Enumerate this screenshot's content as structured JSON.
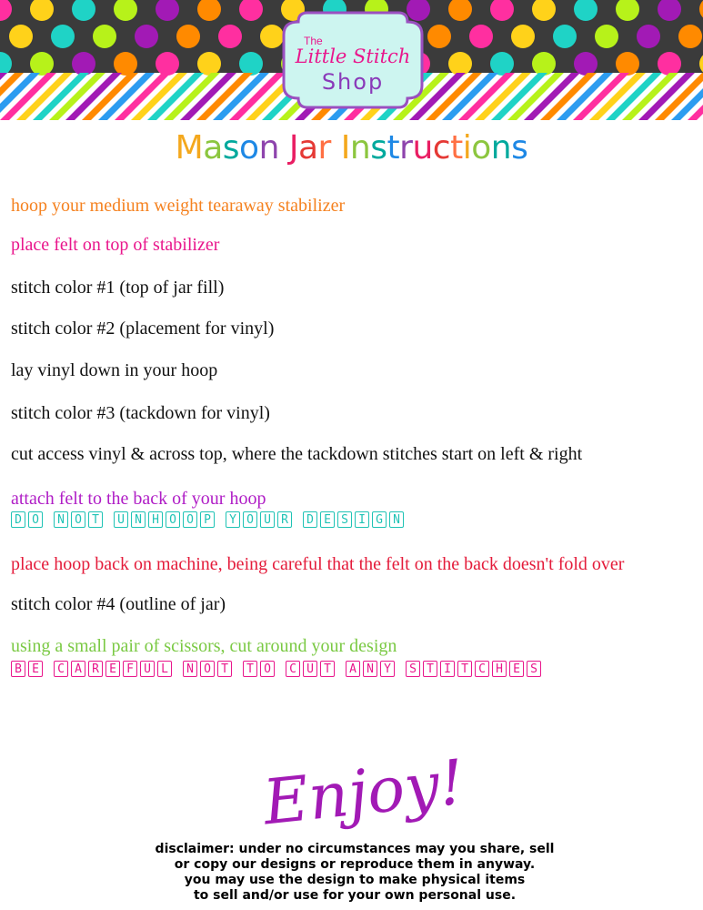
{
  "logo": {
    "the": "The",
    "line1": "Little Stitch",
    "line2": "Shop"
  },
  "title": {
    "text": "Mason Jar Instructions",
    "rainbow": [
      "#f4a81d",
      "#8cc63f",
      "#00a99d",
      "#1e88e5",
      "#8e44ad",
      "#e91e63",
      "#e53935",
      "#ff7043"
    ]
  },
  "steps": [
    {
      "text": "hoop your medium weight tearaway stabilizer",
      "color": "#f58220"
    },
    {
      "text": "place felt on top of stabilizer",
      "color": "#e9168c"
    },
    {
      "text": "stitch color #1 (top of jar fill)",
      "color": "#111111"
    },
    {
      "text": "stitch color #2 (placement for vinyl)",
      "color": "#111111"
    },
    {
      "text": "lay vinyl down in your hoop",
      "color": "#111111"
    },
    {
      "text": "stitch color #3 (tackdown for vinyl)",
      "color": "#111111"
    },
    {
      "text": "cut access vinyl & across top, where the tackdown stitches start on left & right",
      "color": "#111111"
    },
    {
      "text": "attach felt to the back of your hoop",
      "color": "#b01ec6"
    },
    {
      "text": "DO NOT UNHOOP YOUR DESIGN",
      "color": "#1fc3b5",
      "boxed": true
    },
    {
      "text": "place hoop back on machine, being careful that the felt on the back doesn't fold over",
      "color": "#e41b3a"
    },
    {
      "text": "stitch color #4 (outline of jar)",
      "color": "#111111"
    },
    {
      "text": "using a small pair of scissors, cut around your design",
      "color": "#7ac943"
    },
    {
      "text": "BE CAREFUL NOT TO CUT ANY STITCHES",
      "color": "#e9168c",
      "boxed": true
    }
  ],
  "enjoy": "Enjoy!",
  "disclaimer": [
    "disclaimer: under no circumstances may you share, sell",
    "or copy our designs or reproduce them in anyway.",
    "you may use the design to make physical items",
    "to sell and/or use for your own personal use."
  ],
  "colors": {
    "header_dark": "#3b3b3b",
    "polka": [
      "#ff2fa0",
      "#ffd21a",
      "#1fd3c6",
      "#b7f21a",
      "#a21ab5",
      "#ff8a00"
    ],
    "stripes": [
      "#ff2fa0",
      "#ffd21a",
      "#1fd3c6",
      "#b7f21a",
      "#a21ab5",
      "#ff8a00",
      "#2c9cf0"
    ],
    "logo_fill": "#cdf5f0",
    "logo_border": "#9a4fc0"
  }
}
